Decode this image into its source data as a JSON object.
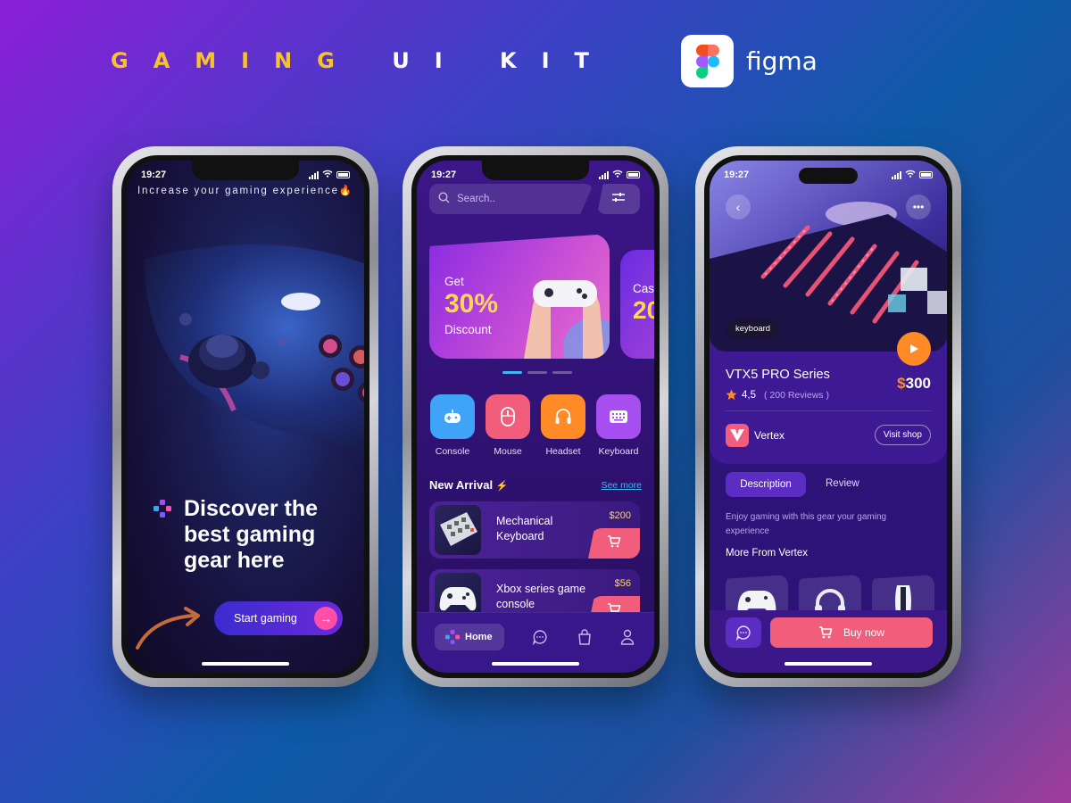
{
  "header": {
    "title_gold": "GAMING",
    "title_white": "UI KIT",
    "figma_label": "figma"
  },
  "phone1": {
    "time": "19:27",
    "tagline": "Increase your gaming experience🔥",
    "headline": "Discover the best gaming gear here",
    "cta": "Start gaming"
  },
  "phone2": {
    "time": "19:27",
    "search_placeholder": "Search..",
    "banner": {
      "get": "Get",
      "percent": "30%",
      "discount": "Discount"
    },
    "banner2": {
      "line1": "Cas",
      "line2": "20"
    },
    "categories": [
      {
        "label": "Console",
        "color": "#3fa3f7"
      },
      {
        "label": "Mouse",
        "color": "#f25d7b"
      },
      {
        "label": "Headset",
        "color": "#ff8a26"
      },
      {
        "label": "Keyboard",
        "color": "#a74ef0"
      }
    ],
    "new_arrival": "New Arrival",
    "see_more": "See more",
    "items": [
      {
        "name": "Mechanical Keyboard",
        "price": "$200"
      },
      {
        "name": "Xbox series game console",
        "price": "$56"
      }
    ],
    "nav": {
      "home": "Home"
    }
  },
  "phone3": {
    "time": "19:27",
    "chip": "keyboard",
    "title": "VTX5 PRO Series",
    "price_currency": "$",
    "price_value": "300",
    "rating": "4,5",
    "reviews": "( 200 Reviews )",
    "brand": "Vertex",
    "visit": "Visit shop",
    "tabs": {
      "description": "Description",
      "review": "Review"
    },
    "description": "Enjoy gaming with this gear your gaming experience",
    "more_from": "More From Vertex",
    "buy": "Buy now"
  }
}
